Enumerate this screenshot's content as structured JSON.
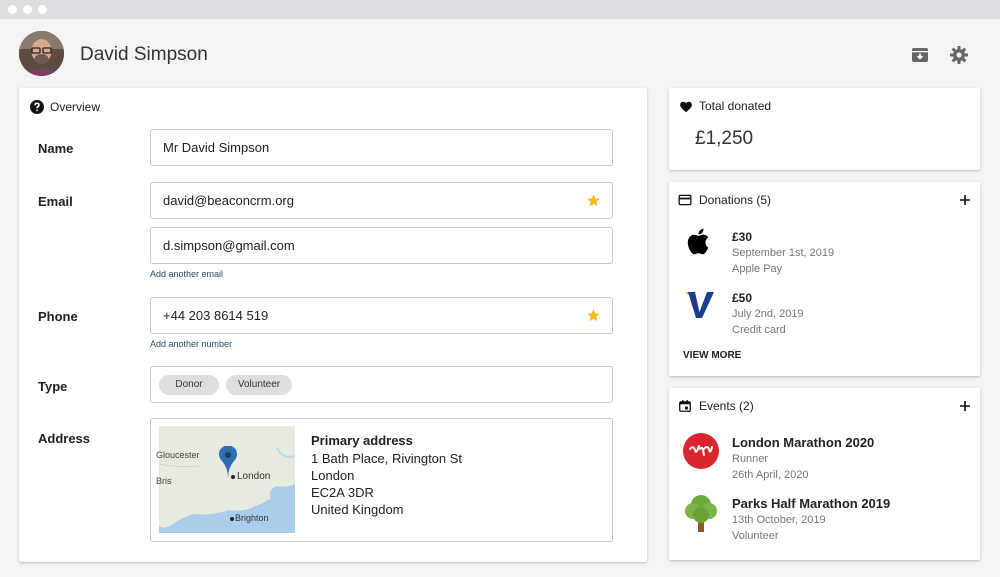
{
  "window": {
    "dot_color": "#ffffff"
  },
  "header": {
    "title": "David Simpson",
    "avatar_icon": "person-photo",
    "archive_icon": "archive-box-icon",
    "settings_icon": "gear-icon"
  },
  "overview": {
    "title": "Overview",
    "icon": "question-circle-icon",
    "name_label": "Name",
    "name_value": "Mr David Simpson",
    "email_label": "Email",
    "emails": [
      "david@beaconcrm.org",
      "d.simpson@gmail.com"
    ],
    "add_email": "Add another email",
    "phone_label": "Phone",
    "phone_value": "+44 203 8614 519",
    "add_number": "Add another number",
    "type_label": "Type",
    "types": [
      "Donor",
      "Volunteer"
    ],
    "address_label": "Address",
    "address": {
      "title": "Primary address",
      "lines": [
        "1 Bath Place, Rivington St",
        "London",
        "EC2A 3DR",
        "United Kingdom"
      ],
      "map_labels": [
        "Gloucester",
        "London",
        "Bristol",
        "Brighton"
      ]
    },
    "star_color": "#f5b921"
  },
  "total": {
    "title": "Total donated",
    "icon": "heart-icon",
    "amount": "£1,250"
  },
  "donations": {
    "title": "Donations (5)",
    "icon": "credit-card-icon",
    "items": [
      {
        "amount": "£30",
        "date": "September 1st, 2019",
        "method": "Apple Pay",
        "logo": "apple-icon"
      },
      {
        "amount": "£50",
        "date": "July 2nd, 2019",
        "method": "Credit card",
        "logo": "visa-icon"
      }
    ],
    "view_more": "VIEW MORE"
  },
  "events": {
    "title": "Events (2)",
    "icon": "calendar-icon",
    "items": [
      {
        "name": "London Marathon 2020",
        "role": "Runner",
        "date": "26th April, 2020",
        "logo": "virgin-icon"
      },
      {
        "name": "Parks Half Marathon 2019",
        "role": "Volunteer",
        "date": "13th October, 2019",
        "logo": "tree-icon"
      }
    ]
  }
}
